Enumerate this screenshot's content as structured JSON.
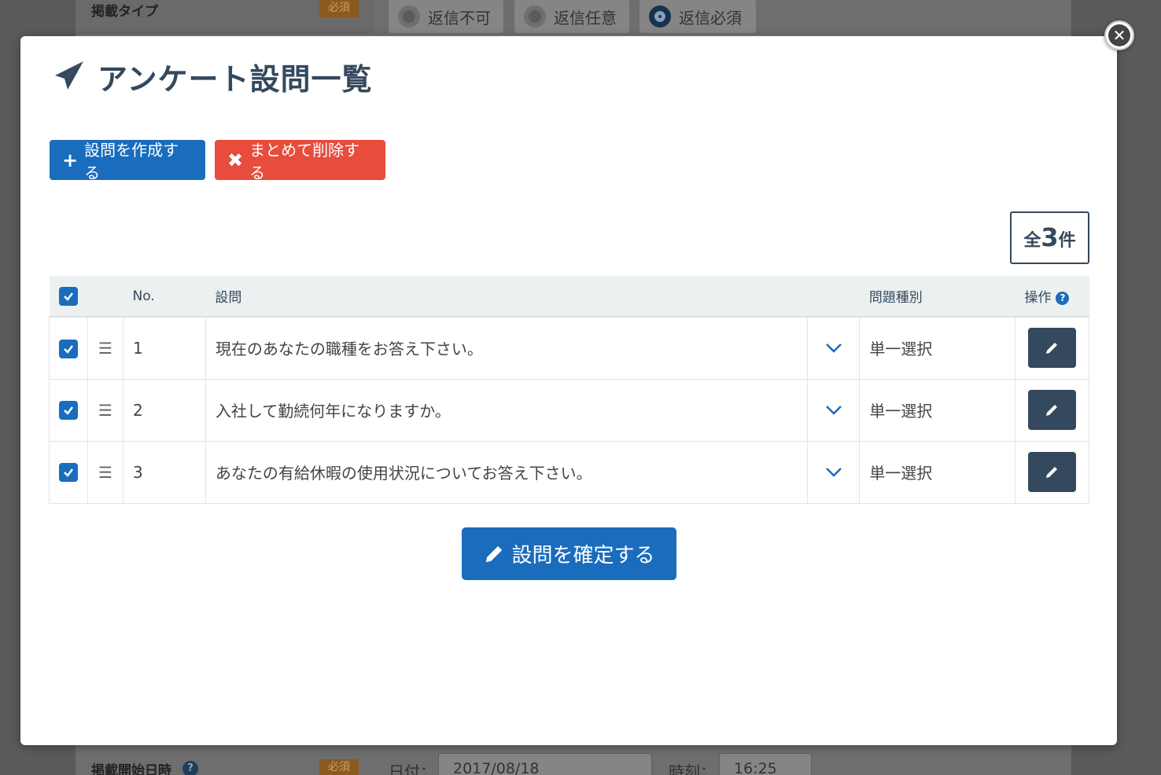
{
  "background": {
    "type_label": "掲載タイプ",
    "required_badge": "必須",
    "radio_options": [
      "返信不可",
      "返信任意",
      "返信必須"
    ],
    "start_label": "掲載開始日時",
    "required_badge2": "必須",
    "date_label": "日付：",
    "date_value": "2017/08/18",
    "time_label": "時刻：",
    "time_value": "16:25"
  },
  "modal": {
    "title": "アンケート設問一覧",
    "title_icon": "paper-plane-icon",
    "create_button": "設問を作成する",
    "delete_button": "まとめて削除する",
    "count_prefix": "全",
    "count_value": "3",
    "count_suffix": "件",
    "confirm_button": "設問を確定する"
  },
  "table": {
    "headers": {
      "no": "No.",
      "question": "設問",
      "type": "問題種別",
      "operation": "操作"
    },
    "rows": [
      {
        "no": "1",
        "question": "現在のあなたの職種をお答え下さい。",
        "type": "単一選択"
      },
      {
        "no": "2",
        "question": "入社して勤続何年になりますか。",
        "type": "単一選択"
      },
      {
        "no": "3",
        "question": "あなたの有給休暇の使用状況についてお答え下さい。",
        "type": "単一選択"
      }
    ]
  },
  "colors": {
    "primary": "#1a6cbd",
    "danger": "#e74c3c",
    "dark": "#34495e"
  }
}
